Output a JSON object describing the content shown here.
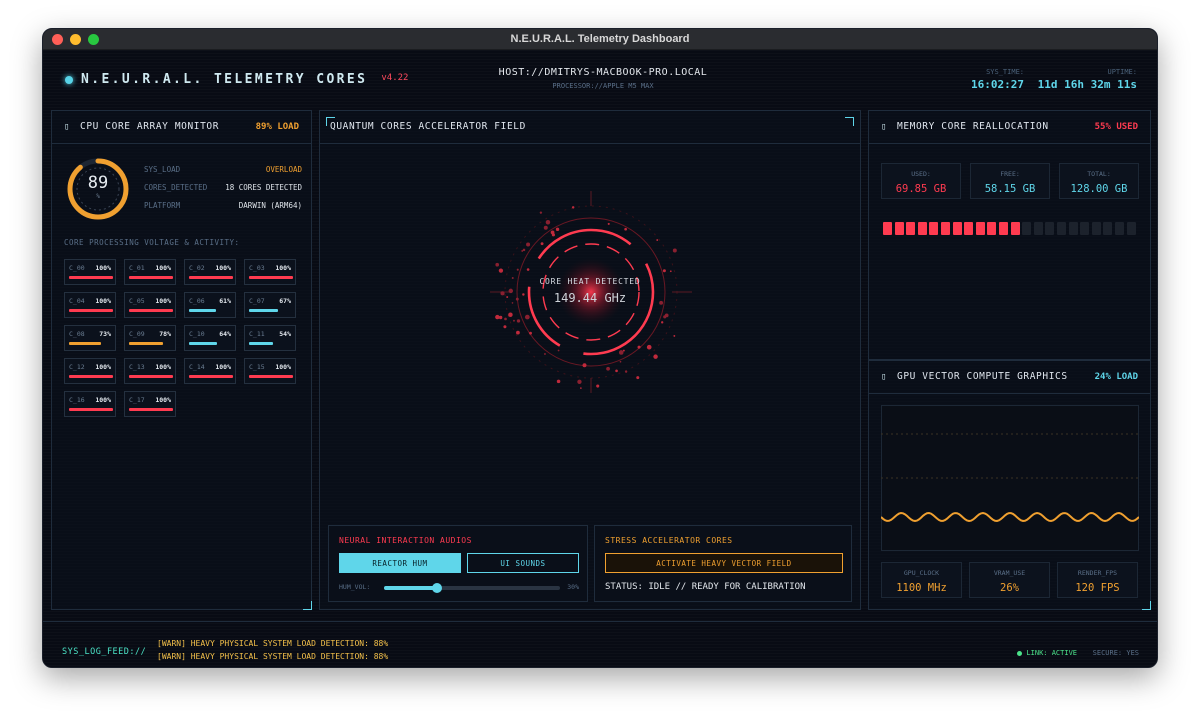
{
  "window": {
    "title": "N.E.U.R.A.L. Telemetry Dashboard"
  },
  "colors": {
    "accent": "#5fd6ea",
    "red": "#ff3b50",
    "orange": "#f0a030",
    "green": "#4be38a"
  },
  "header": {
    "brand": "N.E.U.R.A.L. TELEMETRY CORES",
    "version": "v4.22",
    "host": "HOST://DMITRYS-MACBOOK-PRO.LOCAL",
    "processor": "PROCESSOR://APPLE M5 MAX",
    "sys_time_label": "SYS_TIME:",
    "sys_time": "16:02:27",
    "uptime_label": "UPTIME:",
    "uptime": "11d 16h 32m 11s"
  },
  "cpu": {
    "title": "CPU CORE ARRAY MONITOR",
    "icon": "chip-icon",
    "load_tag": "89% LOAD",
    "gauge_value": "89",
    "gauge_unit": "%",
    "gauge_fraction": 0.89,
    "stats": [
      {
        "k": "SYS_LOAD",
        "v": "OVERLOAD"
      },
      {
        "k": "CORES_DETECTED",
        "v": "18 CORES DETECTED"
      },
      {
        "k": "PLATFORM",
        "v": "DARWIN (ARM64)"
      }
    ],
    "subtitle": "CORE PROCESSING VOLTAGE & ACTIVITY:",
    "cores": [
      {
        "name": "C_00",
        "pct": "100%",
        "value": 100
      },
      {
        "name": "C_01",
        "pct": "100%",
        "value": 100
      },
      {
        "name": "C_02",
        "pct": "100%",
        "value": 100
      },
      {
        "name": "C_03",
        "pct": "100%",
        "value": 100
      },
      {
        "name": "C_04",
        "pct": "100%",
        "value": 100
      },
      {
        "name": "C_05",
        "pct": "100%",
        "value": 100
      },
      {
        "name": "C_06",
        "pct": "61%",
        "value": 61
      },
      {
        "name": "C_07",
        "pct": "67%",
        "value": 67
      },
      {
        "name": "C_08",
        "pct": "73%",
        "value": 73
      },
      {
        "name": "C_09",
        "pct": "78%",
        "value": 78
      },
      {
        "name": "C_10",
        "pct": "64%",
        "value": 64
      },
      {
        "name": "C_11",
        "pct": "54%",
        "value": 54
      },
      {
        "name": "C_12",
        "pct": "100%",
        "value": 100
      },
      {
        "name": "C_13",
        "pct": "100%",
        "value": 100
      },
      {
        "name": "C_14",
        "pct": "100%",
        "value": 100
      },
      {
        "name": "C_15",
        "pct": "100%",
        "value": 100
      },
      {
        "name": "C_16",
        "pct": "100%",
        "value": 100
      },
      {
        "name": "C_17",
        "pct": "100%",
        "value": 100
      }
    ]
  },
  "quantum": {
    "title": "QUANTUM CORES ACCELERATOR FIELD",
    "heat_label": "CORE HEAT DETECTED",
    "heat_value": "149.44 GHz",
    "audio": {
      "title": "NEURAL INTERACTION AUDIOS",
      "reactor_btn": "REACTOR HUM",
      "ui_btn": "UI SOUNDS",
      "vol_label": "HUM_VOL:",
      "vol_value": "30%",
      "vol_fraction": 0.3
    },
    "stress": {
      "title": "STRESS ACCELERATOR CORES",
      "btn": "ACTIVATE HEAVY VECTOR FIELD",
      "status": "STATUS: IDLE // READY FOR CALIBRATION"
    }
  },
  "memory": {
    "title": "MEMORY CORE REALLOCATION",
    "icon": "memory-icon",
    "used_tag": "55% USED",
    "boxes": [
      {
        "k": "USED:",
        "v": "69.85 GB"
      },
      {
        "k": "FREE:",
        "v": "58.15 GB"
      },
      {
        "k": "TOTAL:",
        "v": "128.00 GB"
      }
    ],
    "used_segments": 12,
    "total_segments": 22
  },
  "gpu": {
    "title": "GPU VECTOR COMPUTE GRAPHICS",
    "icon": "gpu-icon",
    "load_tag": "24% LOAD",
    "boxes": [
      {
        "k": "GPU_CLOCK",
        "v": "1100 MHz"
      },
      {
        "k": "VRAM_USE",
        "v": "26%"
      },
      {
        "k": "RENDER_FPS",
        "v": "120 FPS"
      }
    ]
  },
  "footer": {
    "log_label": "SYS_LOG_FEED://",
    "logs": [
      "[WARN] HEAVY PHYSICAL SYSTEM LOAD DETECTION: 88%",
      "[WARN] HEAVY PHYSICAL SYSTEM LOAD DETECTION: 88%"
    ],
    "link": "LINK: ACTIVE",
    "secure": "SECURE: YES"
  }
}
